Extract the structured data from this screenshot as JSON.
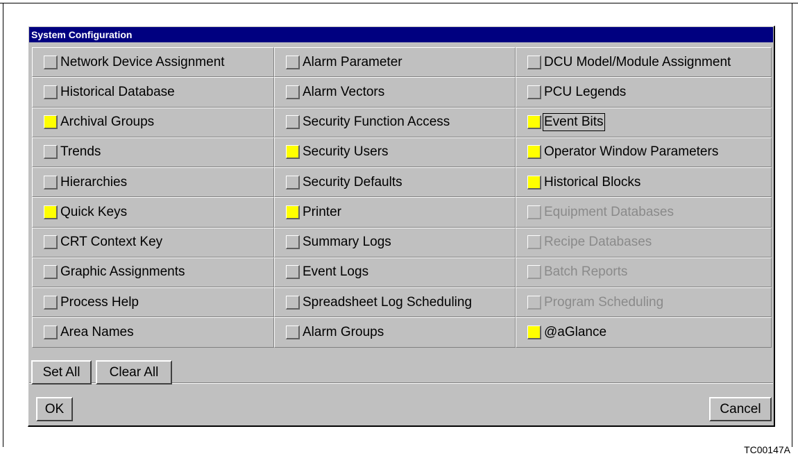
{
  "dialog": {
    "title": "System Configuration",
    "options": [
      {
        "label": "Network Device Assignment",
        "checked": false,
        "enabled": true
      },
      {
        "label": "Alarm Parameter",
        "checked": false,
        "enabled": true
      },
      {
        "label": "DCU Model/Module Assignment",
        "checked": false,
        "enabled": true
      },
      {
        "label": "Historical Database",
        "checked": false,
        "enabled": true
      },
      {
        "label": "Alarm Vectors",
        "checked": false,
        "enabled": true
      },
      {
        "label": "PCU Legends",
        "checked": false,
        "enabled": true
      },
      {
        "label": "Archival Groups",
        "checked": true,
        "enabled": true
      },
      {
        "label": "Security Function Access",
        "checked": false,
        "enabled": true
      },
      {
        "label": "Event Bits",
        "checked": true,
        "enabled": true,
        "focused": true
      },
      {
        "label": "Trends",
        "checked": false,
        "enabled": true
      },
      {
        "label": "Security Users",
        "checked": true,
        "enabled": true
      },
      {
        "label": "Operator Window Parameters",
        "checked": true,
        "enabled": true
      },
      {
        "label": "Hierarchies",
        "checked": false,
        "enabled": true
      },
      {
        "label": "Security Defaults",
        "checked": false,
        "enabled": true
      },
      {
        "label": "Historical Blocks",
        "checked": true,
        "enabled": true
      },
      {
        "label": "Quick Keys",
        "checked": true,
        "enabled": true
      },
      {
        "label": "Printer",
        "checked": true,
        "enabled": true
      },
      {
        "label": "Equipment Databases",
        "checked": false,
        "enabled": false
      },
      {
        "label": "CRT Context Key",
        "checked": false,
        "enabled": true
      },
      {
        "label": "Summary Logs",
        "checked": false,
        "enabled": true
      },
      {
        "label": "Recipe Databases",
        "checked": false,
        "enabled": false
      },
      {
        "label": "Graphic Assignments",
        "checked": false,
        "enabled": true
      },
      {
        "label": "Event Logs",
        "checked": false,
        "enabled": true
      },
      {
        "label": "Batch Reports",
        "checked": false,
        "enabled": false
      },
      {
        "label": "Process Help",
        "checked": false,
        "enabled": true
      },
      {
        "label": "Spreadsheet Log Scheduling",
        "checked": false,
        "enabled": true
      },
      {
        "label": "Program Scheduling",
        "checked": false,
        "enabled": false
      },
      {
        "label": "Area Names",
        "checked": false,
        "enabled": true
      },
      {
        "label": "Alarm Groups",
        "checked": false,
        "enabled": true
      },
      {
        "label": "@aGlance",
        "checked": true,
        "enabled": true
      }
    ],
    "buttons": {
      "set_all": "Set All",
      "clear_all": "Clear All",
      "ok": "OK",
      "cancel": "Cancel"
    }
  },
  "figure_id": "TC00147A",
  "colors": {
    "title_bar": "#000080",
    "checked": "#ffff00",
    "face": "#c0c0c0"
  }
}
